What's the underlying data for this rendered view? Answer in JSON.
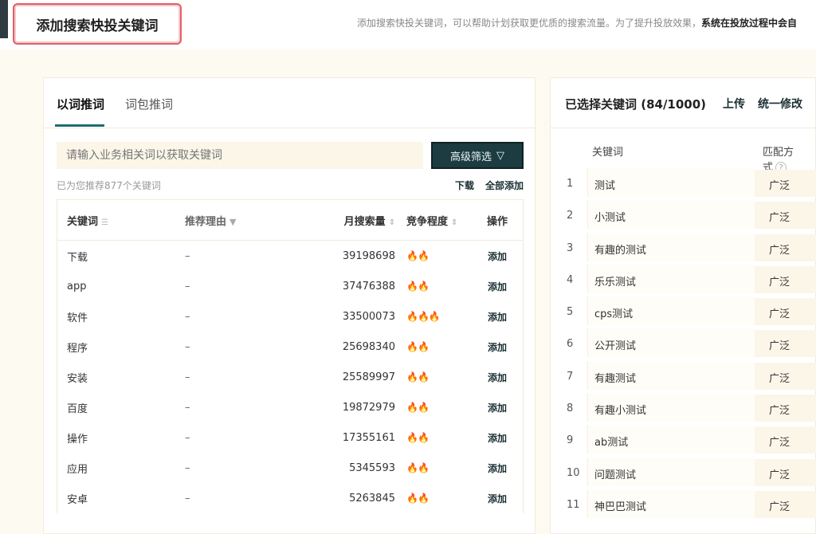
{
  "header": {
    "title": "添加搜索快投关键词",
    "description": "添加搜索快投关键词，可以帮助计划获取更优质的搜索流量。为了提升投放效果，",
    "description_bold": "系统在投放过程中会自"
  },
  "left": {
    "tabs": [
      {
        "label": "以词推词",
        "active": true
      },
      {
        "label": "词包推词",
        "active": false
      }
    ],
    "search_placeholder": "请输入业务相关词以获取关键词",
    "advanced_filter_label": "高级筛选",
    "recommend_text": "已为您推荐877个关键词",
    "download_label": "下载",
    "add_all_label": "全部添加",
    "columns": {
      "keyword": "关键词",
      "reason": "推荐理由",
      "volume": "月搜索量",
      "competition": "竞争程度",
      "action": "操作"
    },
    "rows": [
      {
        "keyword": "下载",
        "reason": "–",
        "volume": "39198698",
        "flames": 2,
        "action": "添加"
      },
      {
        "keyword": "app",
        "reason": "–",
        "volume": "37476388",
        "flames": 2,
        "action": "添加"
      },
      {
        "keyword": "软件",
        "reason": "–",
        "volume": "33500073",
        "flames": 3,
        "action": "添加"
      },
      {
        "keyword": "程序",
        "reason": "–",
        "volume": "25698340",
        "flames": 2,
        "action": "添加"
      },
      {
        "keyword": "安装",
        "reason": "–",
        "volume": "25589997",
        "flames": 2,
        "action": "添加"
      },
      {
        "keyword": "百度",
        "reason": "–",
        "volume": "19872979",
        "flames": 2,
        "action": "添加"
      },
      {
        "keyword": "操作",
        "reason": "–",
        "volume": "17355161",
        "flames": 2,
        "action": "添加"
      },
      {
        "keyword": "应用",
        "reason": "–",
        "volume": "5345593",
        "flames": 2,
        "action": "添加"
      },
      {
        "keyword": "安卓",
        "reason": "–",
        "volume": "5263845",
        "flames": 2,
        "action": "添加"
      }
    ]
  },
  "right": {
    "title": "已选择关键词 (84/1000)",
    "upload_label": "上传",
    "batch_label": "统一修改",
    "col_keyword": "关键词",
    "col_match": "匹配方式",
    "rows": [
      {
        "idx": "1",
        "keyword": "测试",
        "match": "广泛"
      },
      {
        "idx": "2",
        "keyword": "小测试",
        "match": "广泛"
      },
      {
        "idx": "3",
        "keyword": "有趣的测试",
        "match": "广泛"
      },
      {
        "idx": "4",
        "keyword": "乐乐测试",
        "match": "广泛"
      },
      {
        "idx": "5",
        "keyword": "cps测试",
        "match": "广泛"
      },
      {
        "idx": "6",
        "keyword": "公开测试",
        "match": "广泛"
      },
      {
        "idx": "7",
        "keyword": "有趣测试",
        "match": "广泛"
      },
      {
        "idx": "8",
        "keyword": "有趣小测试",
        "match": "广泛"
      },
      {
        "idx": "9",
        "keyword": "ab测试",
        "match": "广泛"
      },
      {
        "idx": "10",
        "keyword": "问题测试",
        "match": "广泛"
      },
      {
        "idx": "11",
        "keyword": "神巴巴测试",
        "match": "广泛"
      }
    ]
  }
}
